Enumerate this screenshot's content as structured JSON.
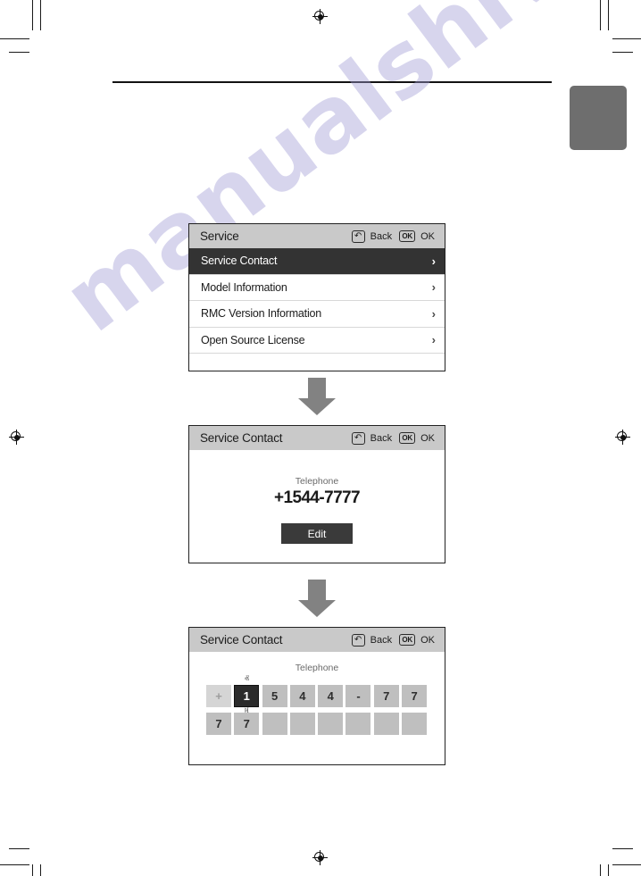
{
  "page": {
    "chapter_tab": "",
    "watermark": "manualshive.com",
    "accent_gray": "#6e6e6e",
    "header_bar_color": "#c9c9c9",
    "selected_row_color": "#333333",
    "arrow_color": "#828282"
  },
  "panels": [
    {
      "id": "service-menu",
      "title": "Service",
      "keys": {
        "back_icon": "↶",
        "back_label": "Back",
        "ok_icon": "OK",
        "ok_label": "OK"
      },
      "rows": [
        {
          "label": "Service Contact",
          "chevron": "›",
          "selected": true
        },
        {
          "label": "Model Information",
          "chevron": "›",
          "selected": false
        },
        {
          "label": "RMC Version Information",
          "chevron": "›",
          "selected": false
        },
        {
          "label": "Open Source License",
          "chevron": "›",
          "selected": false
        }
      ]
    },
    {
      "id": "service-contact-view",
      "title": "Service Contact",
      "keys": {
        "back_icon": "↶",
        "back_label": "Back",
        "ok_icon": "OK",
        "ok_label": "OK"
      },
      "telephone_label": "Telephone",
      "telephone_value": "+1544-7777",
      "edit_button": "Edit"
    },
    {
      "id": "service-contact-edit",
      "title": "Service Contact",
      "keys": {
        "back_icon": "↶",
        "back_label": "Back",
        "ok_icon": "OK",
        "ok_label": "OK"
      },
      "telephone_label": "Telephone",
      "caret_up": "ⱏ",
      "caret_down": "ⱝ",
      "keypad": {
        "row1": [
          {
            "value": "+",
            "state": "dim"
          },
          {
            "value": "1",
            "state": "active"
          },
          {
            "value": "5",
            "state": "normal"
          },
          {
            "value": "4",
            "state": "normal"
          },
          {
            "value": "4",
            "state": "normal"
          },
          {
            "value": "-",
            "state": "normal"
          },
          {
            "value": "7",
            "state": "normal"
          },
          {
            "value": "7",
            "state": "normal"
          }
        ],
        "row2": [
          {
            "value": "7",
            "state": "normal"
          },
          {
            "value": "7",
            "state": "normal"
          },
          {
            "value": "",
            "state": "blank"
          },
          {
            "value": "",
            "state": "blank"
          },
          {
            "value": "",
            "state": "blank"
          },
          {
            "value": "",
            "state": "blank"
          },
          {
            "value": "",
            "state": "blank"
          },
          {
            "value": "",
            "state": "blank"
          }
        ]
      }
    }
  ]
}
